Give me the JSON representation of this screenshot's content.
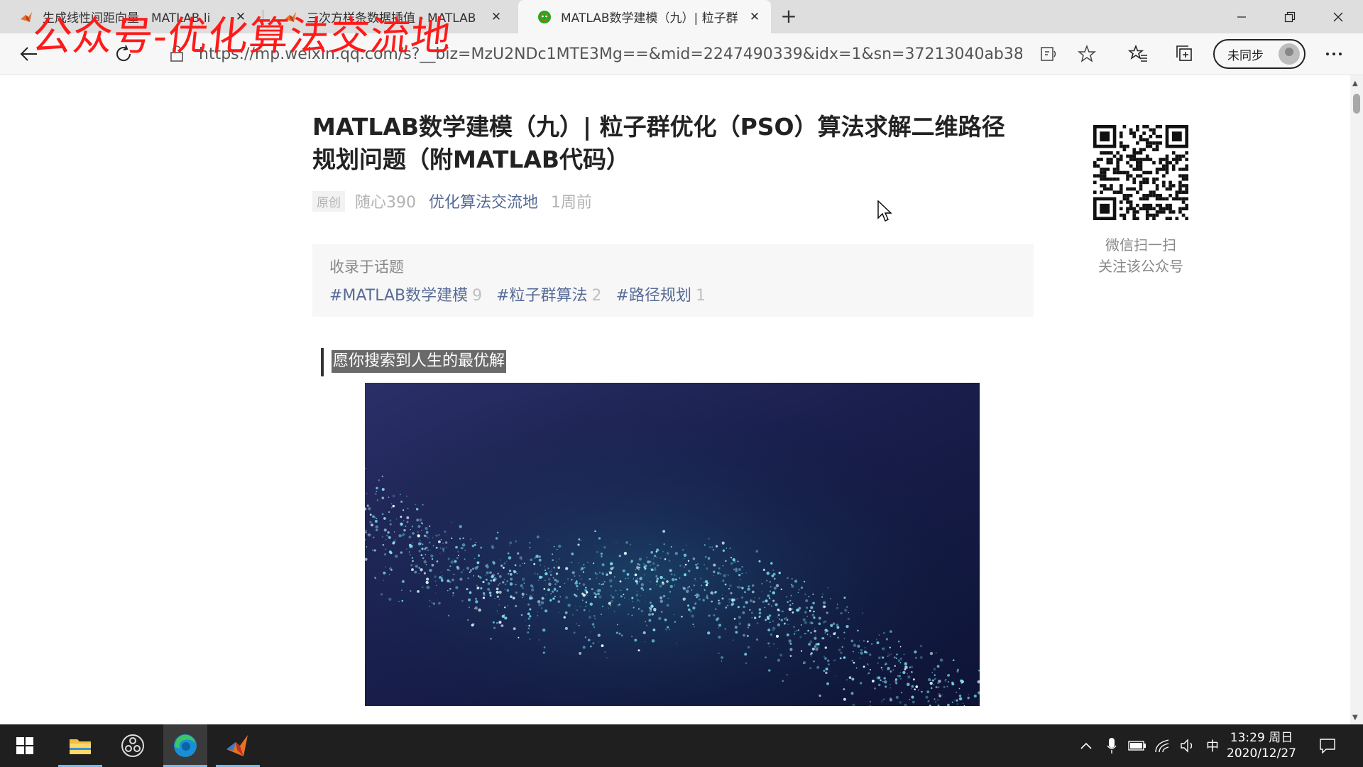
{
  "watermark": "公众号-优化算法交流地",
  "browser": {
    "tabs": [
      {
        "label": "生成线性间距向量 - MATLAB li",
        "icon": "matlab-icon",
        "active": false
      },
      {
        "label": "三次方样条数据插值 - MATLAB",
        "icon": "matlab-icon",
        "active": false
      },
      {
        "label": "MATLAB数学建模（九）| 粒子群",
        "icon": "wechat-icon",
        "active": true
      }
    ],
    "new_tab_label": "+",
    "url": "https://mp.weixin.qq.com/s?__biz=MzU2NDc1MTE3Mg==&mid=2247490339&idx=1&sn=37213040ab384f...",
    "sync_label": "未同步"
  },
  "article": {
    "title": "MATLAB数学建模（九）| 粒子群优化（PSO）算法求解二维路径规划问题（附MATLAB代码）",
    "original_badge": "原创",
    "author": "随心390",
    "account": "优化算法交流地",
    "published": "1周前",
    "topics_heading": "收录于话题",
    "topics": [
      {
        "name": "#MATLAB数学建模",
        "count": "9"
      },
      {
        "name": "#粒子群算法",
        "count": "2"
      },
      {
        "name": "#路径规划",
        "count": "1"
      }
    ],
    "motto": "愿你搜索到人生的最优解",
    "qr_caption_line1": "微信扫一扫",
    "qr_caption_line2": "关注该公众号"
  },
  "taskbar": {
    "time": "13:29 周日",
    "date": "2020/12/27",
    "ime": "中"
  },
  "colors": {
    "link": "#576b95",
    "watermark": "#ff1a1a",
    "taskbar": "#1f1f1f"
  }
}
